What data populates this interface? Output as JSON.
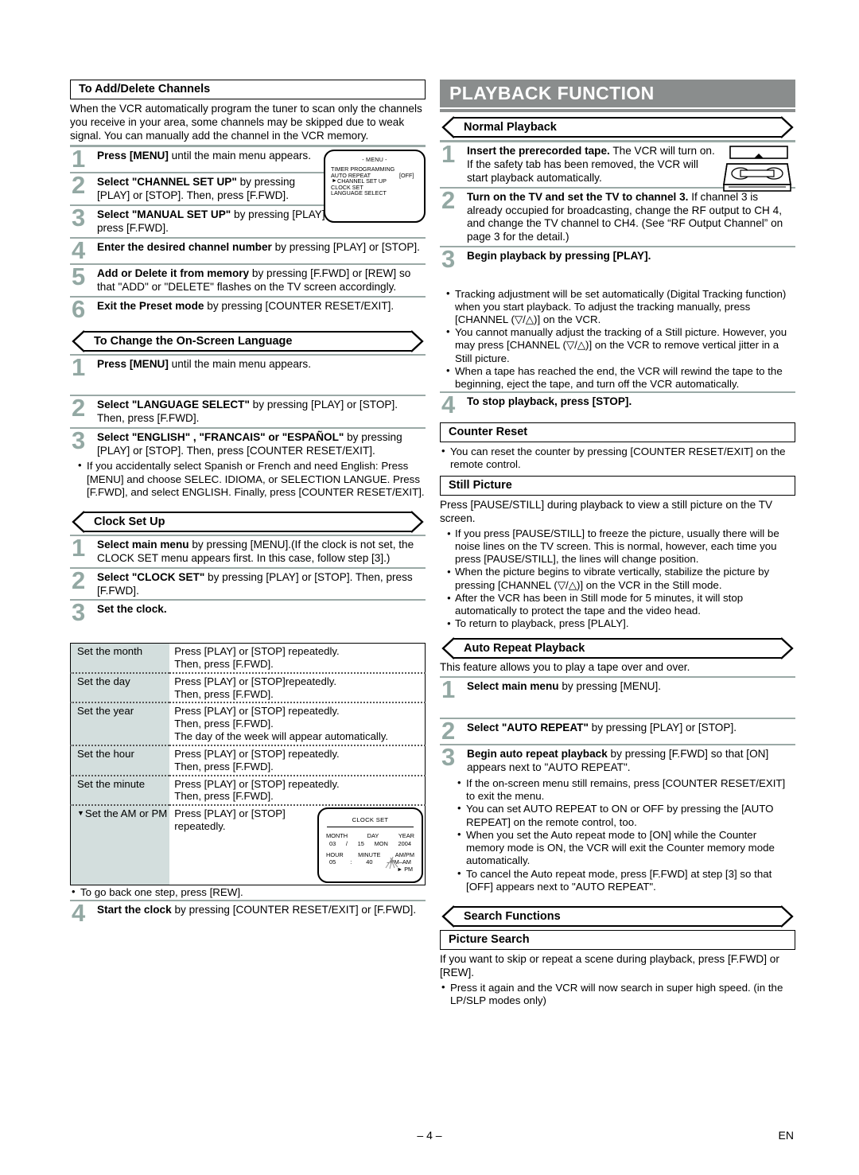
{
  "page": {
    "number": "– 4 –",
    "lang": "EN"
  },
  "left": {
    "add_delete": {
      "title": "To Add/Delete Channels",
      "intro": "When the VCR automatically program the tuner to scan only the channels you receive in your area, some channels may be skipped due to weak signal. You can manually add the channel in the VCR memory.",
      "steps": [
        {
          "n": "1",
          "bold": "Press [MENU]",
          "rest": " until the main menu appears."
        },
        {
          "n": "2",
          "bold": "Select \"CHANNEL SET UP\"",
          "rest": " by pressing [PLAY] or [STOP]. Then, press [F.FWD]."
        },
        {
          "n": "3",
          "bold": "Select \"MANUAL SET UP\"",
          "rest": " by pressing [PLAY] or [STOP]. Then, press [F.FWD]."
        },
        {
          "n": "4",
          "bold": "Enter the desired channel number",
          "rest": " by pressing [PLAY] or [STOP]."
        },
        {
          "n": "5",
          "bold": "Add or Delete it from memory",
          "rest": " by pressing [F.FWD] or [REW] so that \"ADD\" or \"DELETE\" flashes on the TV screen accordingly."
        },
        {
          "n": "6",
          "bold": "Exit the Preset mode",
          "rest": " by pressing [COUNTER RESET/EXIT]."
        }
      ]
    },
    "osd_menu": {
      "title": "- MENU -",
      "rows": [
        "TIMER PROGRAMMING",
        "AUTO REPEAT",
        "CHANNEL SET UP",
        "CLOCK SET",
        "LANGUAGE SELECT"
      ],
      "auto_repeat_value": "[OFF]",
      "cursor_row": "CHANNEL SET UP",
      "cursor_glyph": "►"
    },
    "language": {
      "title": "To Change the On-Screen Language",
      "steps": [
        {
          "n": "1",
          "bold": "Press [MENU]",
          "rest": " until the main menu appears."
        },
        {
          "n": "2",
          "bold": "Select \"LANGUAGE SELECT\"",
          "rest": " by pressing [PLAY] or [STOP]. Then, press [F.FWD]."
        },
        {
          "n": "3",
          "bold": "Select \"ENGLISH\" , \"FRANCAIS\" or \"ESPAÑOL\"",
          "rest": " by pressing [PLAY] or  [STOP]. Then, press [COUNTER RESET/EXIT]."
        }
      ],
      "note": "If you accidentally select Spanish or French and need English: Press [MENU] and choose SELEC. IDIOMA, or SELECTION LANGUE.  Press [F.FWD], and select ENGLISH. Finally, press [COUNTER RESET/EXIT]."
    },
    "clock": {
      "title": "Clock Set Up",
      "steps": [
        {
          "n": "1",
          "bold": "Select main menu",
          "rest": " by pressing [MENU].(If the clock is not set, the CLOCK SET menu appears first. In this case, follow step [3].)"
        },
        {
          "n": "2",
          "bold": "Select \"CLOCK SET\"",
          "rest": " by pressing [PLAY] or [STOP]. Then, press [F.FWD]."
        },
        {
          "n": "3",
          "bold": "Set the clock.",
          "rest": ""
        }
      ],
      "table": [
        {
          "label": "Set the month",
          "lines": [
            "Press [PLAY] or [STOP] repeatedly.",
            "Then, press [F.FWD]."
          ]
        },
        {
          "label": "Set the day",
          "lines": [
            "Press [PLAY] or [STOP]repeatedly.",
            "Then, press [F.FWD]."
          ]
        },
        {
          "label": "Set the year",
          "lines": [
            "Press [PLAY] or [STOP] repeatedly.",
            "Then, press [F.FWD].",
            "The day of the week will appear automatically."
          ]
        },
        {
          "label": "Set the hour",
          "lines": [
            "Press [PLAY] or [STOP] repeatedly.",
            "Then, press [F.FWD]."
          ]
        },
        {
          "label": "Set the minute",
          "lines": [
            "Press [PLAY] or [STOP] repeatedly.",
            "Then, press [F.FWD]."
          ]
        },
        {
          "label": "Set the AM or PM",
          "lines": [
            "Press [PLAY] or [STOP]",
            "repeatedly."
          ]
        }
      ],
      "osd_clock": {
        "title": "CLOCK SET",
        "h_month": "MONTH",
        "h_day": "DAY",
        "h_year": "YEAR",
        "v_month": "03",
        "v_sep": "/",
        "v_day": "15",
        "v_dow": "MON",
        "v_year": "2004",
        "h_hour": "HOUR",
        "h_minute": "MINUTE",
        "h_ampm": "AM/PM",
        "v_hour": "05",
        "v_colon": ":",
        "v_minute": "40",
        "v_ampm_top": "PM",
        "v_ampm_top2": "AM",
        "v_ampm_sel": "PM",
        "v_ampm_arrow": "►"
      },
      "back_note": "To go back one step, press [REW].",
      "step4": {
        "n": "4",
        "bold": "Start the clock",
        "rest": " by pressing [COUNTER RESET/EXIT] or [F.FWD]."
      }
    }
  },
  "right": {
    "banner": "PLAYBACK FUNCTION",
    "normal": {
      "title": "Normal Playback",
      "steps": [
        {
          "n": "1",
          "bold": "Insert the prerecorded tape.",
          "rest": " The VCR will turn on. If the safety tab has been removed, the VCR will start playback automatically."
        },
        {
          "n": "2",
          "bold": "Turn on the TV and set the TV to channel 3.",
          "rest": " If channel 3 is already occupied for broadcasting, change the RF output to CH 4, and change the TV channel to CH4. (See “RF Output Channel” on page 3 for the detail.)"
        },
        {
          "n": "3",
          "bold": "Begin playback by pressing [PLAY].",
          "rest": ""
        },
        {
          "n": "4",
          "bold": "To stop playback, press [STOP].",
          "rest": ""
        }
      ],
      "bullets": [
        "Tracking adjustment will be set automatically (Digital Tracking function) when you start playback. To adjust the tracking manually, press [CHANNEL (▽/△)] on the VCR.",
        "You cannot manually adjust the tracking of a Still picture. However, you may press [CHANNEL (▽/△)] on the VCR to remove vertical jitter in a Still picture.",
        "When a tape has reached the end, the VCR will rewind the tape to the beginning, eject the tape, and turn off the VCR automatically."
      ]
    },
    "counter_reset": {
      "title": "Counter Reset",
      "bullet": "You can reset the counter by pressing [COUNTER RESET/EXIT] on the remote control."
    },
    "still": {
      "title": "Still Picture",
      "intro": "Press [PAUSE/STILL] during playback to view a still picture on the TV screen.",
      "bullets": [
        "If you press [PAUSE/STILL] to freeze the picture, usually there will be noise lines on the TV screen. This is normal, however, each time you press [PAUSE/STILL], the lines will change position.",
        "When the picture begins to vibrate vertically, stabilize the picture by pressing [CHANNEL (▽/△)] on the VCR in the Still mode.",
        "After the VCR has been in Still mode for 5 minutes, it will stop automatically to protect the tape and the video head.",
        "To return to playback, press [PLALY]."
      ]
    },
    "auto_repeat": {
      "title": "Auto Repeat Playback",
      "intro": "This feature allows you to play a tape over and over.",
      "steps": [
        {
          "n": "1",
          "bold": "Select main menu",
          "rest": " by pressing [MENU]."
        },
        {
          "n": "2",
          "bold": "Select \"AUTO REPEAT\"",
          "rest": " by pressing [PLAY] or [STOP]."
        },
        {
          "n": "3",
          "bold": "Begin auto repeat playback",
          "rest": " by pressing [F.FWD] so that [ON] appears next to \"AUTO REPEAT\"."
        }
      ],
      "bullets": [
        "If the on-screen menu still remains, press [COUNTER RESET/EXIT] to exit the menu.",
        "You can set AUTO REPEAT to ON or OFF by pressing the [AUTO REPEAT] on the remote control, too.",
        "When you set the Auto repeat mode to [ON] while the Counter memory mode is ON, the VCR will exit the Counter memory mode automatically.",
        "To cancel the Auto repeat mode, press [F.FWD] at step [3] so that [OFF] appears next to \"AUTO REPEAT\"."
      ]
    },
    "search": {
      "title": "Search Functions",
      "picture_search": {
        "title": "Picture Search",
        "intro": "If you want to skip or repeat a scene during playback, press [F.FWD] or [REW].",
        "bullet": "Press it again and the VCR will now search in super high speed. (in the LP/SLP modes only)"
      }
    }
  }
}
